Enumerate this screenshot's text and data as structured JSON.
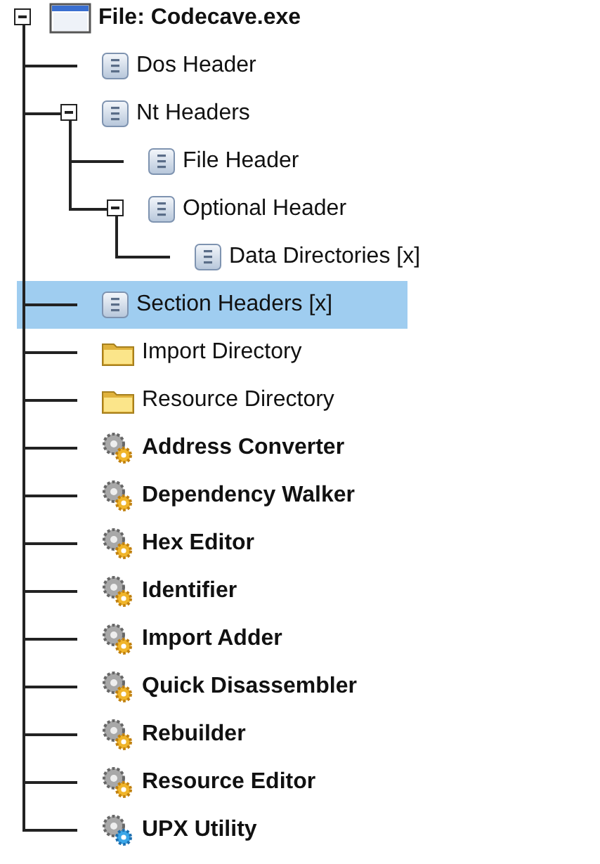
{
  "tree": [
    {
      "label": "File: Codecave.exe",
      "kind": "file",
      "selected": false,
      "expanded": true,
      "children": [
        {
          "label": "Dos Header",
          "kind": "header",
          "selected": false
        },
        {
          "label": "Nt Headers",
          "kind": "header",
          "selected": false,
          "expanded": true,
          "children": [
            {
              "label": "File Header",
              "kind": "header",
              "selected": false
            },
            {
              "label": "Optional Header",
              "kind": "header",
              "selected": false,
              "expanded": true,
              "children": [
                {
                  "label": "Data Directories [x]",
                  "kind": "header",
                  "selected": false
                }
              ]
            }
          ]
        },
        {
          "label": "Section Headers [x]",
          "kind": "header",
          "selected": true
        },
        {
          "label": "Import Directory",
          "kind": "folder",
          "selected": false
        },
        {
          "label": "Resource Directory",
          "kind": "folder",
          "selected": false
        },
        {
          "label": "Address Converter",
          "kind": "tool",
          "selected": false
        },
        {
          "label": "Dependency Walker",
          "kind": "tool",
          "selected": false
        },
        {
          "label": "Hex Editor",
          "kind": "tool",
          "selected": false
        },
        {
          "label": "Identifier",
          "kind": "tool",
          "selected": false
        },
        {
          "label": "Import Adder",
          "kind": "tool",
          "selected": false
        },
        {
          "label": "Quick Disassembler",
          "kind": "tool",
          "selected": false
        },
        {
          "label": "Rebuilder",
          "kind": "tool",
          "selected": false
        },
        {
          "label": "Resource Editor",
          "kind": "tool",
          "selected": false
        },
        {
          "label": "UPX Utility",
          "kind": "upx-tool",
          "selected": false
        }
      ]
    }
  ]
}
